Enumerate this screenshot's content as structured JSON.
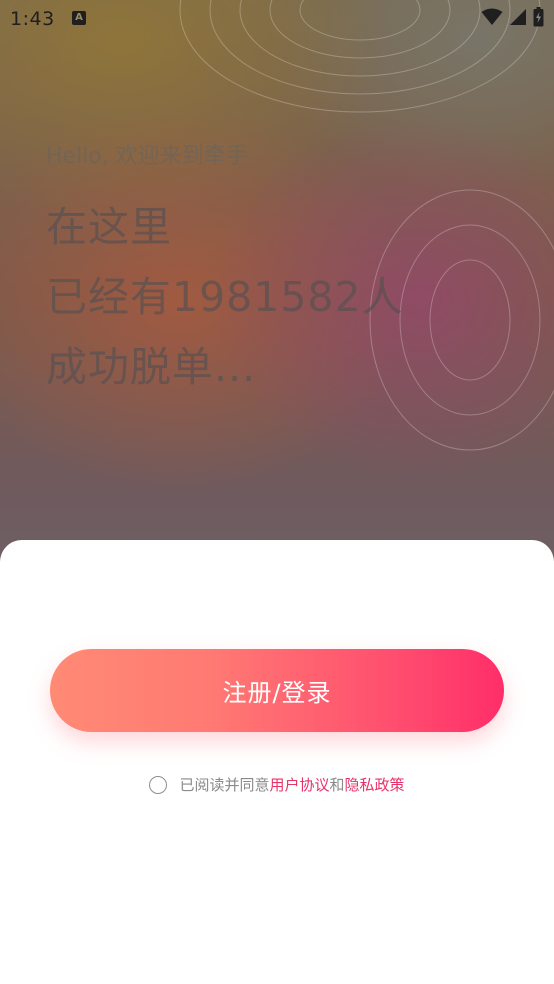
{
  "status_bar": {
    "time": "1:43",
    "notification_glyph": "A",
    "icons": [
      "wifi-icon",
      "cell-signal-icon",
      "battery-icon"
    ]
  },
  "hero": {
    "greeting": "Hello, 欢迎来到牵手",
    "lines": [
      "在这里",
      "已经有1981582人",
      "成功脱单..."
    ]
  },
  "sheet": {
    "primary_button": "注册/登录",
    "agreement": {
      "prefix": "已阅读并同意",
      "user_agreement": "用户协议",
      "conjunction": "和",
      "privacy_policy": "隐私政策"
    }
  },
  "colors": {
    "accent": "#ff3d6e",
    "button_start": "#ff8a74",
    "button_end": "#ff2e69",
    "link": "#e8326a",
    "sheet_background": "#ffffff"
  }
}
